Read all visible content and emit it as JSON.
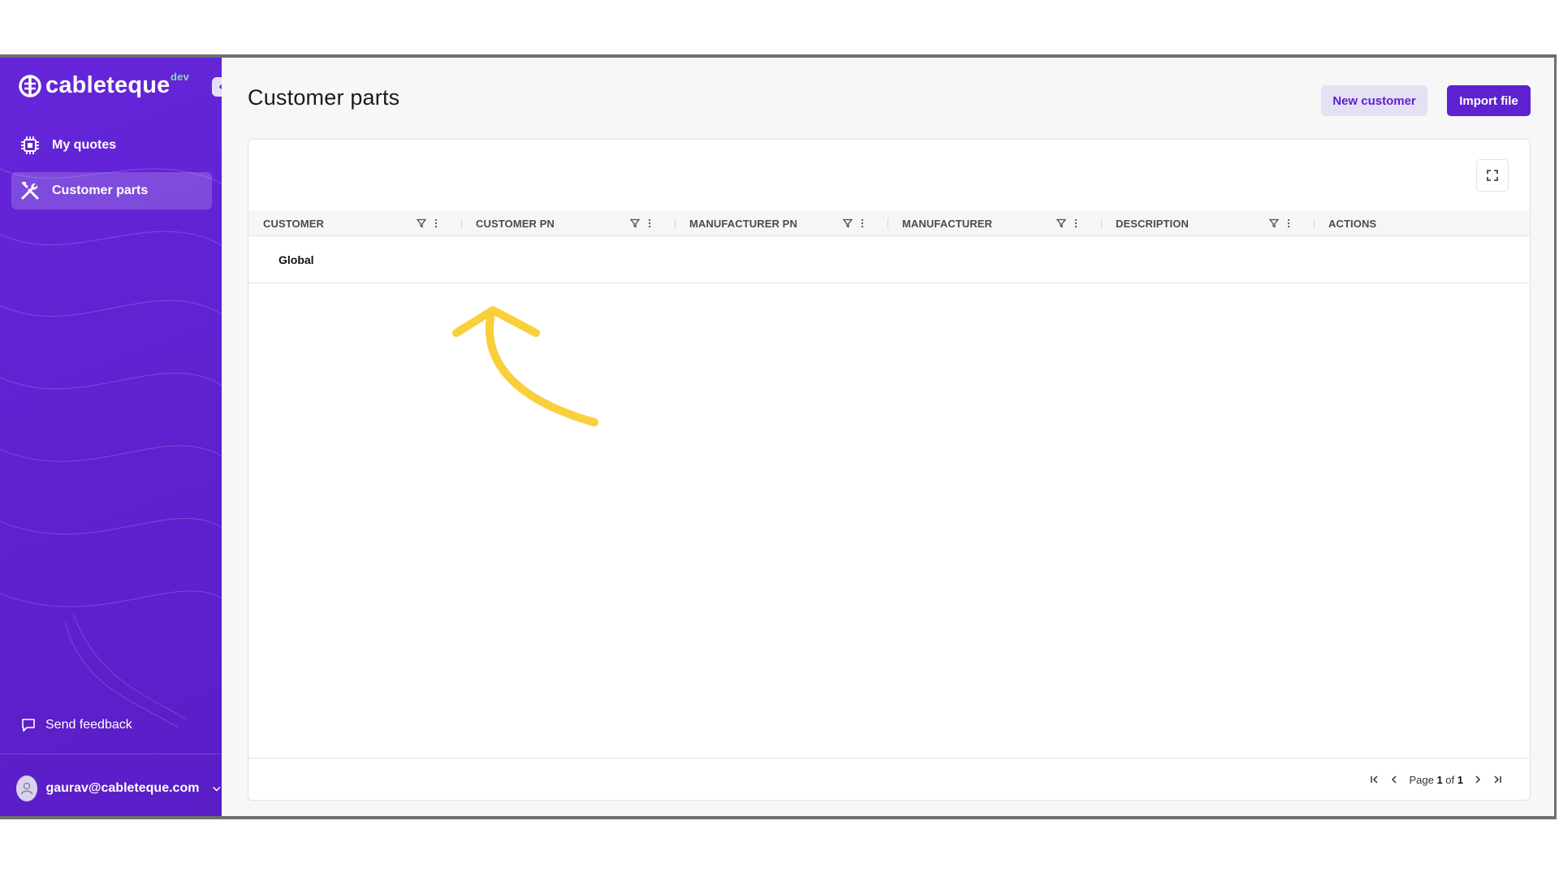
{
  "app": {
    "brand": "cableteque",
    "env_badge": "dev",
    "accent_color": "#5e21cf"
  },
  "sidebar": {
    "items": [
      {
        "label": "My quotes",
        "icon": "chip-icon",
        "active": false
      },
      {
        "label": "Customer parts",
        "icon": "tools-icon",
        "active": true
      }
    ],
    "feedback_label": "Send feedback",
    "user_email": "gaurav@cableteque.com"
  },
  "header": {
    "title": "Customer parts",
    "new_customer_label": "New customer",
    "import_label": "Import file"
  },
  "table": {
    "columns": [
      "CUSTOMER",
      "CUSTOMER PN",
      "MANUFACTURER PN",
      "MANUFACTURER",
      "DESCRIPTION",
      "ACTIONS"
    ],
    "rows": [
      {
        "customer": "Global"
      }
    ]
  },
  "pagination": {
    "page_label": "Page",
    "current": "1",
    "of_label": "of",
    "total": "1"
  },
  "annotation": {
    "arrow_color": "#f9cf3a"
  }
}
